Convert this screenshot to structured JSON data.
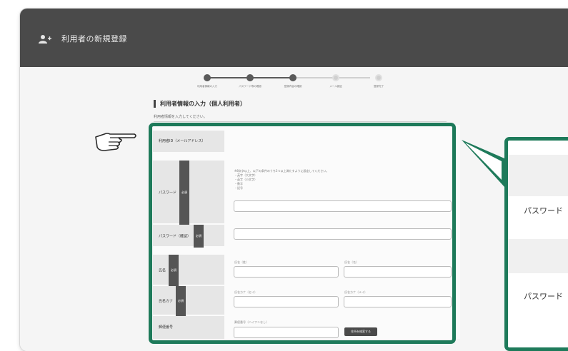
{
  "header": {
    "title": "利用者の新規登録",
    "icon": "user-add-icon"
  },
  "steps": [
    {
      "label": "利用者情報の入力",
      "state": "done"
    },
    {
      "label": "パスワード等の確認",
      "state": "done"
    },
    {
      "label": "登録内容の確認",
      "state": "done"
    },
    {
      "label": "メール認証",
      "state": "todo"
    },
    {
      "label": "登録完了",
      "state": "todo"
    }
  ],
  "section": {
    "title": "利用者情報の入力（個人利用者）",
    "description": "利用者情報を入力してください。"
  },
  "form": {
    "user_id_label": "利用者ID（メールアドレス）",
    "password_label": "パスワード",
    "password_hint": [
      "※8文字以上、以下の条件のうち3つ以上満たすように設定してください。",
      "・英字（大文字）",
      "・英字（小文字）",
      "・数字",
      "・記号"
    ],
    "password_confirm_label": "パスワード（確認）",
    "name_label": "氏名",
    "last_name_small": "氏名（姓）",
    "first_name_small": "氏名（名）",
    "kana_label": "氏名カナ",
    "last_kana_small": "氏名カナ（セイ）",
    "first_kana_small": "氏名カナ（メイ）",
    "postal_label": "郵便番号",
    "postal_small": "郵便番号（ハイフンなし）",
    "address_search_button": "住所を検索する",
    "required_badge": "必須"
  },
  "zoom": {
    "password_label": "パスワード",
    "password_confirm_label_partial": "パスワード"
  },
  "colors": {
    "highlight": "#1e7a5a",
    "header": "#4a4a4a"
  }
}
